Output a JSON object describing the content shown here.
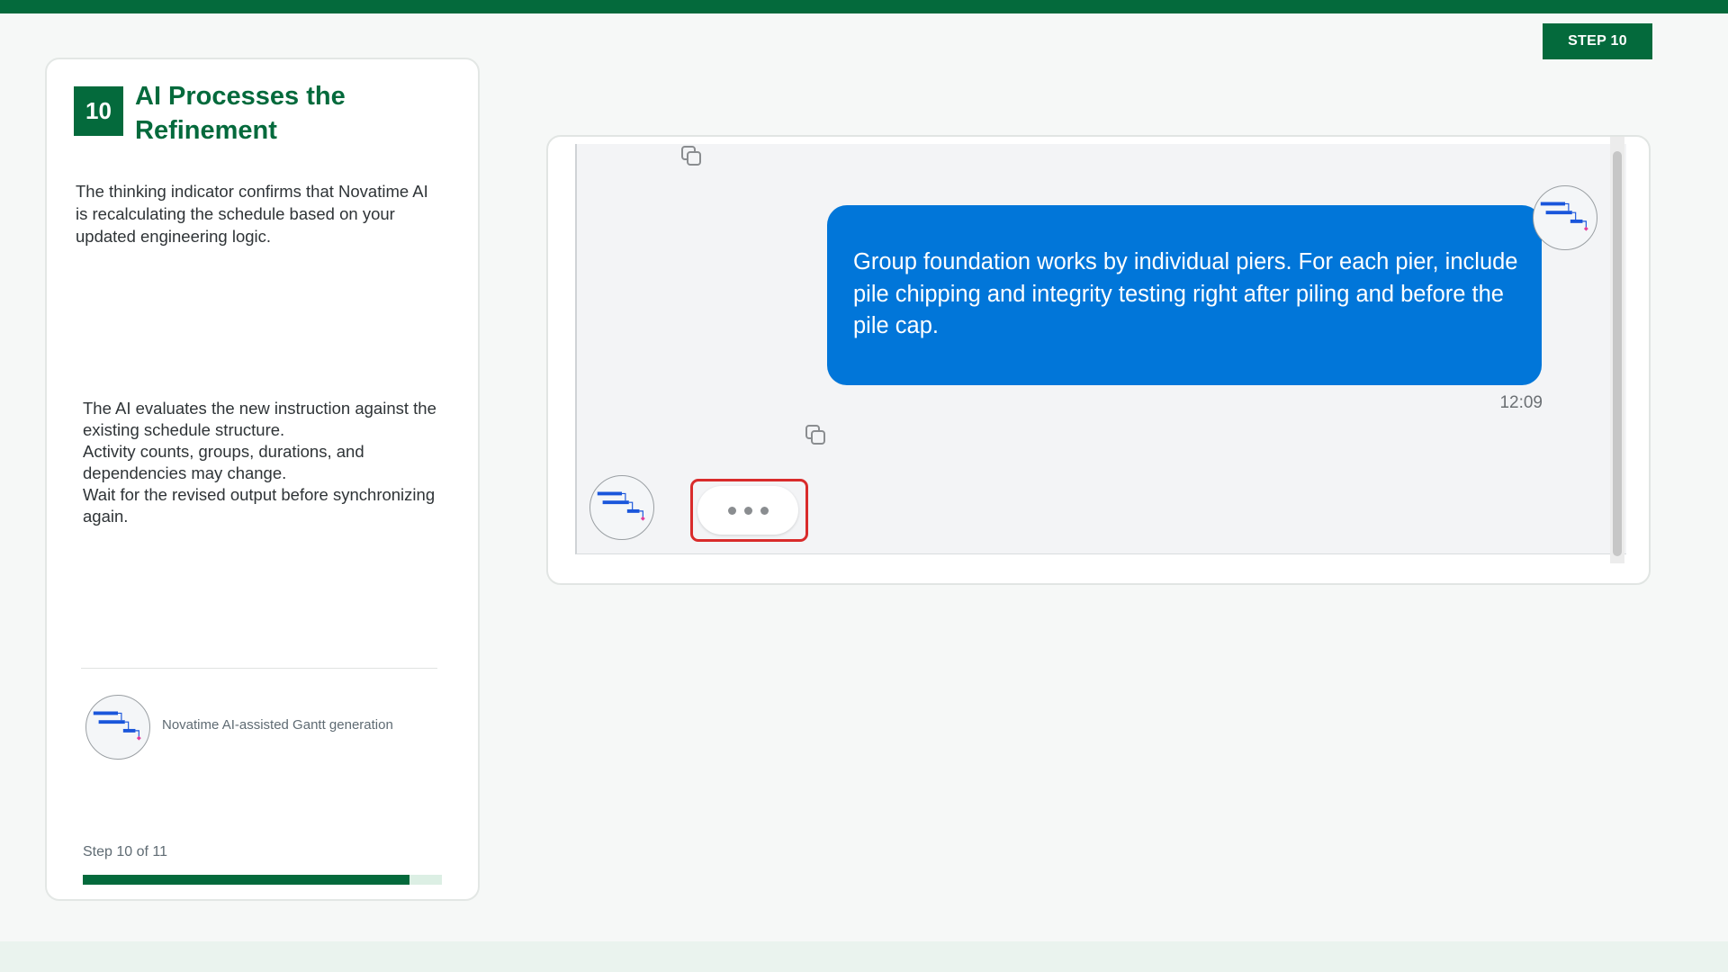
{
  "step_badge": "STEP 10",
  "card": {
    "number": "10",
    "title": "AI Processes the Refinement",
    "description": "The thinking indicator confirms that Novatime AI is recalculating the schedule based on your updated engineering logic.",
    "details": [
      "The AI evaluates the new instruction against the existing schedule structure.",
      "Activity counts, groups, durations, and dependencies may change.",
      "Wait for the revised output before synchronizing again."
    ],
    "brand_caption": "Novatime AI-assisted Gantt generation",
    "step_label": "Step 10 of 11",
    "progress": {
      "current": 10,
      "total": 11
    }
  },
  "chat": {
    "user_message": "Group foundation works by individual piers. For each pier, include pile chipping and integrity testing right after piling and before the pile cap.",
    "timestamp": "12:09",
    "typing_indicator_dots": 3,
    "icons": {
      "copy": "copy-icon",
      "avatar": "gantt-chart-icon"
    }
  },
  "colors": {
    "brand_green": "#046a3c",
    "user_bubble": "#0176d9",
    "highlight": "#d92b2b",
    "progress_track": "#dcefe4",
    "typing_dot": "#8a8d90"
  }
}
